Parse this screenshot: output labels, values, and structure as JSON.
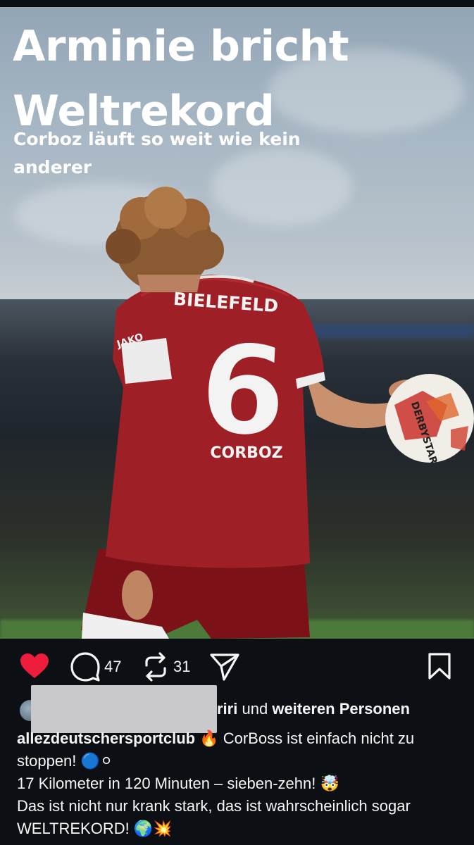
{
  "post": {
    "headline": "Arminie bricht Weltrekord",
    "subline": "Corboz läuft so weit wie kein anderer",
    "jersey": {
      "club": "BIELEFELD",
      "number": "6",
      "name": "CORBOZ",
      "sleeve_brand": "JAKO"
    },
    "ball_text": "DERBYSTAR"
  },
  "actions": {
    "like_icon": "heart-filled-icon",
    "comment_icon": "comment-icon",
    "comment_count": "47",
    "repost_icon": "repost-icon",
    "repost_count": "31",
    "share_icon": "paper-plane-icon",
    "save_icon": "bookmark-icon",
    "like_color": "#ee1d3b"
  },
  "likes": {
    "name_suffix": "riri",
    "connector": "und",
    "others": "weiteren Personen"
  },
  "caption": {
    "username": "allezdeutschersportclub",
    "line1_text": "🔥 CorBoss ist einfach nicht zu stoppen! 🔵⚪",
    "line2": "17 Kilometer in 120 Minuten – sieben-zehn! 🤯",
    "line3": "Das ist nicht nur krank stark, das ist wahrscheinlich sogar WELTREKORD! 🌍💥"
  }
}
